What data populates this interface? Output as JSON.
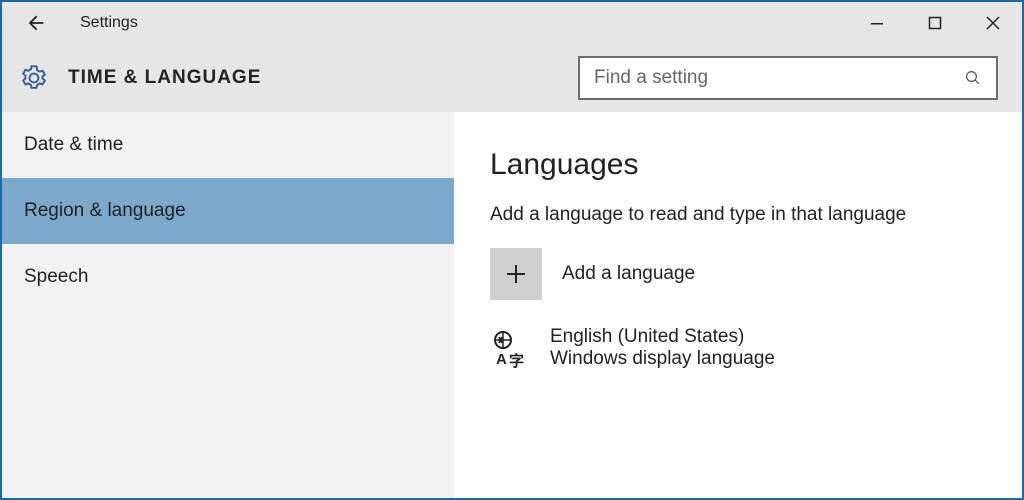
{
  "titlebar": {
    "window_title": "Settings"
  },
  "header": {
    "section_title": "TIME & LANGUAGE",
    "search_placeholder": "Find a setting"
  },
  "sidebar": {
    "items": [
      {
        "label": "Date & time",
        "selected": false
      },
      {
        "label": "Region & language",
        "selected": true
      },
      {
        "label": "Speech",
        "selected": false
      }
    ]
  },
  "content": {
    "heading": "Languages",
    "subtext": "Add a language to read and type in that language",
    "add_language_label": "Add a language",
    "languages": [
      {
        "name": "English (United States)",
        "detail": "Windows display language"
      }
    ]
  }
}
